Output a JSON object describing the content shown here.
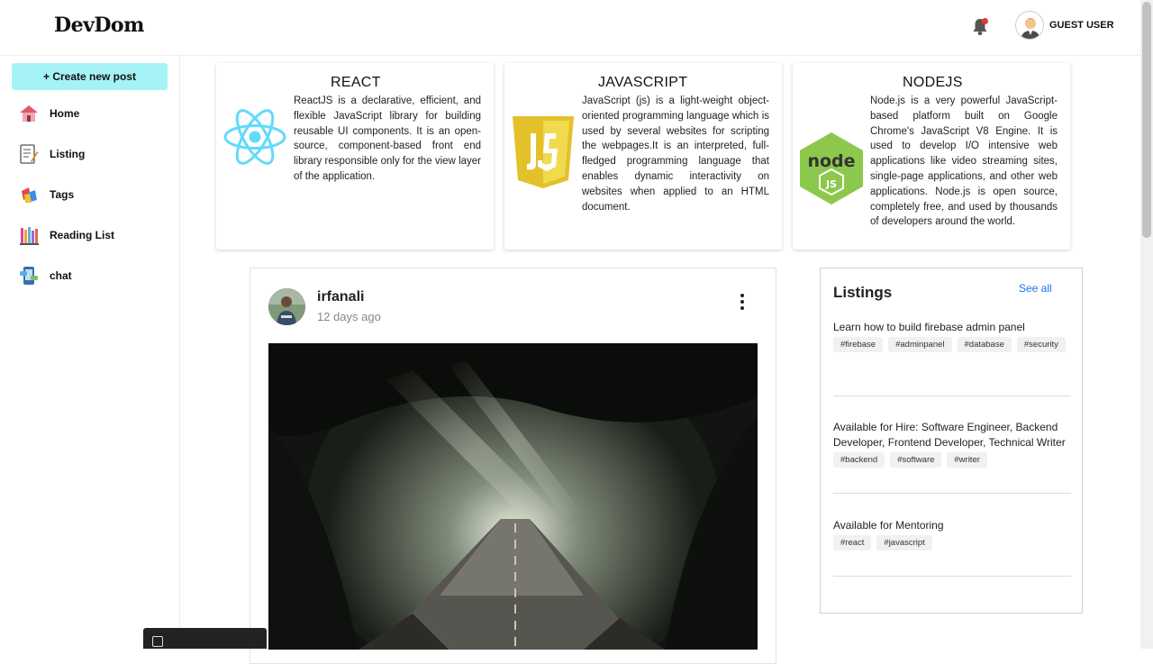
{
  "header": {
    "logo": "DevDom",
    "user_name": "GUEST USER"
  },
  "sidebar": {
    "create_label": "+ Create new post",
    "items": [
      {
        "label": "Home",
        "icon": "home-icon"
      },
      {
        "label": "Listing",
        "icon": "listing-icon"
      },
      {
        "label": "Tags",
        "icon": "tags-icon"
      },
      {
        "label": "Reading List",
        "icon": "reading-list-icon"
      },
      {
        "label": "chat",
        "icon": "chat-icon"
      }
    ]
  },
  "cards": [
    {
      "title": "REACT",
      "text": "ReactJS is a declarative, efficient, and flexible JavaScript library for building reusable UI components. It is an open-source, component-based front end library responsible only for the view layer of the application.",
      "icon": "react-logo-icon"
    },
    {
      "title": "JAVASCRIPT",
      "text": "JavaScript (js) is a light-weight object-oriented programming language which is used by several websites for scripting the webpages.It is an interpreted, full-fledged programming language that enables dynamic interactivity on websites when applied to an HTML document.",
      "icon": "javascript-logo-icon"
    },
    {
      "title": "NODEJS",
      "text": "Node.js is a very powerful JavaScript-based platform built on Google Chrome's JavaScript V8 Engine. It is used to develop I/O intensive web applications like video streaming sites, single-page applications, and other web applications. Node.js is open source, completely free, and used by thousands of developers around the world.",
      "icon": "nodejs-logo-icon"
    }
  ],
  "post": {
    "author": "irfanali",
    "time": "12 days ago"
  },
  "listings": {
    "title": "Listings",
    "see_all": "See all",
    "items": [
      {
        "title": "Learn how to build firebase admin panel",
        "tags": [
          "#firebase",
          "#adminpanel",
          "#database",
          "#security"
        ]
      },
      {
        "title": "Available for Hire: Software Engineer, Backend Developer, Frontend Developer, Technical Writer",
        "tags": [
          "#backend",
          "#software",
          "#writer"
        ]
      },
      {
        "title": "Available for Mentoring",
        "tags": [
          "#react",
          "#javascript"
        ]
      }
    ]
  },
  "colors": {
    "create_button": "#a6f3f7",
    "link": "#1a73e8",
    "react": "#61dafb",
    "javascript": "#f0db4f",
    "nodejs": "#8cc84b"
  }
}
